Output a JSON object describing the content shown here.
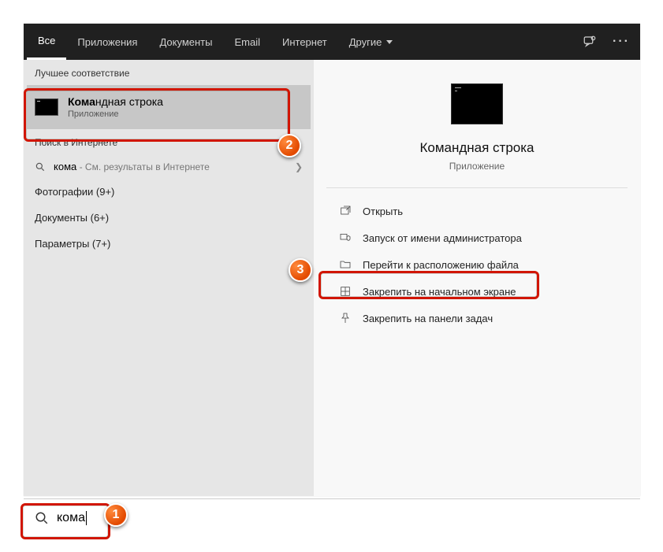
{
  "header": {
    "tabs": {
      "all": "Все",
      "apps": "Приложения",
      "docs": "Документы",
      "email": "Email",
      "internet": "Интернет",
      "other": "Другие"
    }
  },
  "left": {
    "best_match_header": "Лучшее соответствие",
    "best_match": {
      "title_bold": "Кома",
      "title_rest": "ндная строка",
      "subtitle": "Приложение"
    },
    "web_header": "Поиск в Интернете",
    "web": {
      "query": "кома",
      "rest": " - См. результаты в Интернете"
    },
    "categories": {
      "photos": "Фотографии (9+)",
      "documents": "Документы (6+)",
      "settings": "Параметры (7+)"
    }
  },
  "right": {
    "title": "Командная строка",
    "subtitle": "Приложение",
    "actions": {
      "open": "Открыть",
      "run_admin": "Запуск от имени администратора",
      "open_location": "Перейти к расположению файла",
      "pin_start": "Закрепить на начальном экране",
      "pin_taskbar": "Закрепить на панели задач"
    }
  },
  "search": {
    "value": "кома"
  },
  "annotations": {
    "n1": "1",
    "n2": "2",
    "n3": "3"
  }
}
